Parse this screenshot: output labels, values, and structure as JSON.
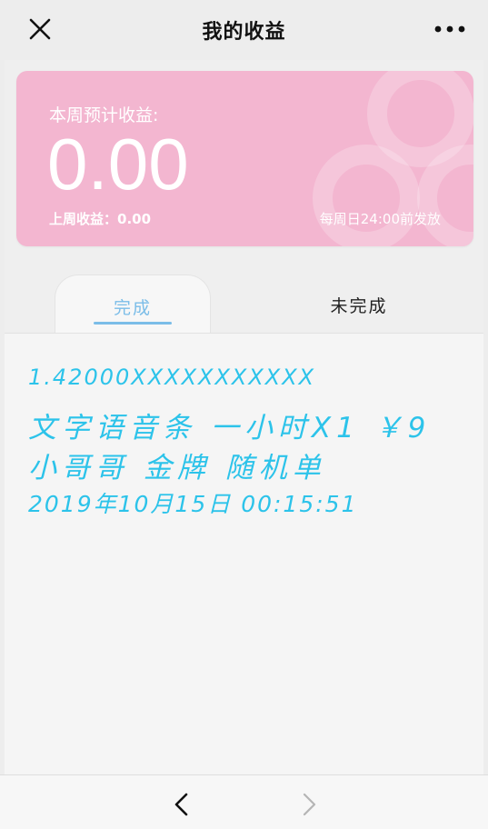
{
  "header": {
    "title": "我的收益",
    "close_icon": "close-icon",
    "more_icon": "more-dots-icon"
  },
  "earnings_card": {
    "week_label": "本周预计收益:",
    "week_amount": "0.00",
    "last_week_label": "上周收益：",
    "last_week_amount": "0.00",
    "pay_note": "每周日24:00前发放",
    "color": "#f3b6d0"
  },
  "tabs": [
    {
      "label": "完成",
      "active": true
    },
    {
      "label": "未完成",
      "active": false
    }
  ],
  "accent_color": "#7bbde8",
  "order": {
    "line1": "1.42000XXXXXXXXXXX",
    "line2": "文字语音条 一小时X1  ￥9",
    "line3": "小哥哥 金牌 随机单",
    "line4": "2019年10月15日 00:15:51",
    "color": "#2cc3ea"
  },
  "bottom_nav": {
    "back_icon": "chevron-left-icon",
    "forward_icon": "chevron-right-icon",
    "forward_enabled": false
  }
}
